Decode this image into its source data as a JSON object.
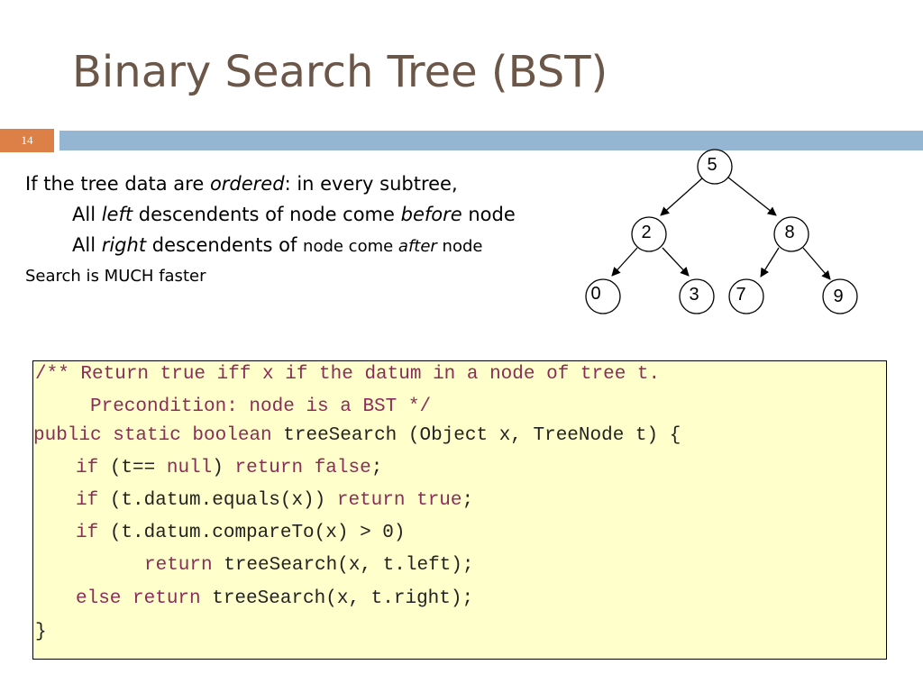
{
  "title": "Binary Search Tree (BST)",
  "slide_number": "14",
  "text": {
    "line1": {
      "a": "If the tree data are ",
      "b": "ordered",
      "c": ": in every subtree,"
    },
    "line2": {
      "a": "All ",
      "b": "left",
      "c": " descendents of node come ",
      "d": "before",
      "e": " node"
    },
    "line3": {
      "a": "All ",
      "b": "right",
      "c": " descendents of ",
      "d": "node come ",
      "e": "after",
      "f": " node"
    },
    "line4": "Search is MUCH faster"
  },
  "tree": {
    "root": "5",
    "left": "2",
    "right": "8",
    "left_left": "0",
    "left_right": "3",
    "right_left": "7",
    "right_right": "9"
  },
  "code": {
    "l1": "/** Return true iff x if the datum in a node of tree t.",
    "l2": "Precondition: node is a BST */",
    "l3a": "public static boolean",
    "l3b": " treeSearch (Object x, TreeNode t) {",
    "l4a": "if",
    "l4b": " (t== ",
    "l4c": "null",
    "l4d": ") ",
    "l4e": "return false",
    "l4f": ";",
    "l5a": "if",
    "l5b": " (t.datum.equals(x)) ",
    "l5c": "return true",
    "l5d": ";",
    "l6a": "if",
    "l6b": " (t.datum.compareTo(x) > 0)",
    "l7a": "return",
    "l7b": " treeSearch(x, t.left);",
    "l8a": "else return",
    "l8b": " treeSearch(x, t.right);",
    "l9": "}"
  }
}
